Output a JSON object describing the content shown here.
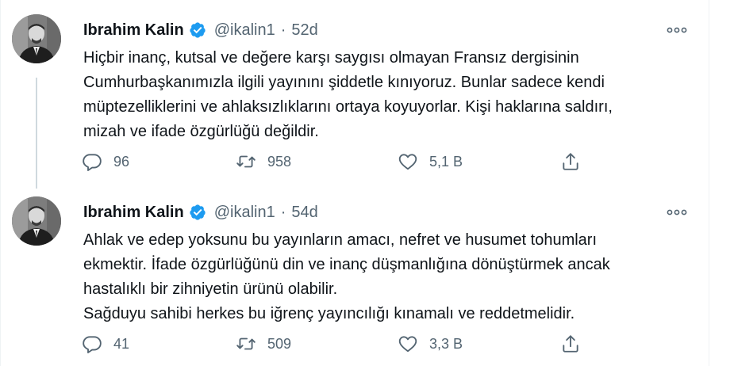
{
  "tweets": [
    {
      "author": {
        "name": "Ibrahim Kalin",
        "handle": "@ikalin1"
      },
      "separator": "·",
      "time": "52d",
      "lines": [
        "Hiçbir inanç, kutsal ve değere karşı saygısı olmayan Fransız dergisinin",
        "Cumhurbaşkanımızla ilgili yayınını şiddetle kınıyoruz. Bunlar sadece kendi",
        "müptezelliklerini ve ahlaksızlıklarını ortaya koyuyorlar. Kişi haklarına saldırı,",
        "mizah ve ifade özgürlüğü değildir."
      ],
      "actions": {
        "replies": "96",
        "retweets": "958",
        "likes": "5,1 B"
      }
    },
    {
      "author": {
        "name": "Ibrahim Kalin",
        "handle": "@ikalin1"
      },
      "separator": "·",
      "time": "54d",
      "lines": [
        "Ahlak ve edep yoksunu bu yayınların amacı, nefret ve husumet tohumları",
        "ekmektir. İfade özgürlüğünü din ve inanç düşmanlığına dönüştürmek ancak",
        "hastalıklı bir zihniyetin ürünü olabilir.",
        "Sağduyu sahibi herkes bu iğrenç yayıncılığı kınamalı ve reddetmelidir."
      ],
      "actions": {
        "replies": "41",
        "retweets": "509",
        "likes": "3,3 B"
      }
    }
  ],
  "icons": {
    "verified": "verified-badge-icon",
    "more": "more-options-icon",
    "reply": "reply-icon",
    "retweet": "retweet-icon",
    "like": "like-icon",
    "share": "share-icon"
  },
  "colors": {
    "verified": "#1d9bf0",
    "text": "#0f1419",
    "secondary": "#536471",
    "thread_line": "#cfd9de",
    "border": "#eff3f4"
  }
}
